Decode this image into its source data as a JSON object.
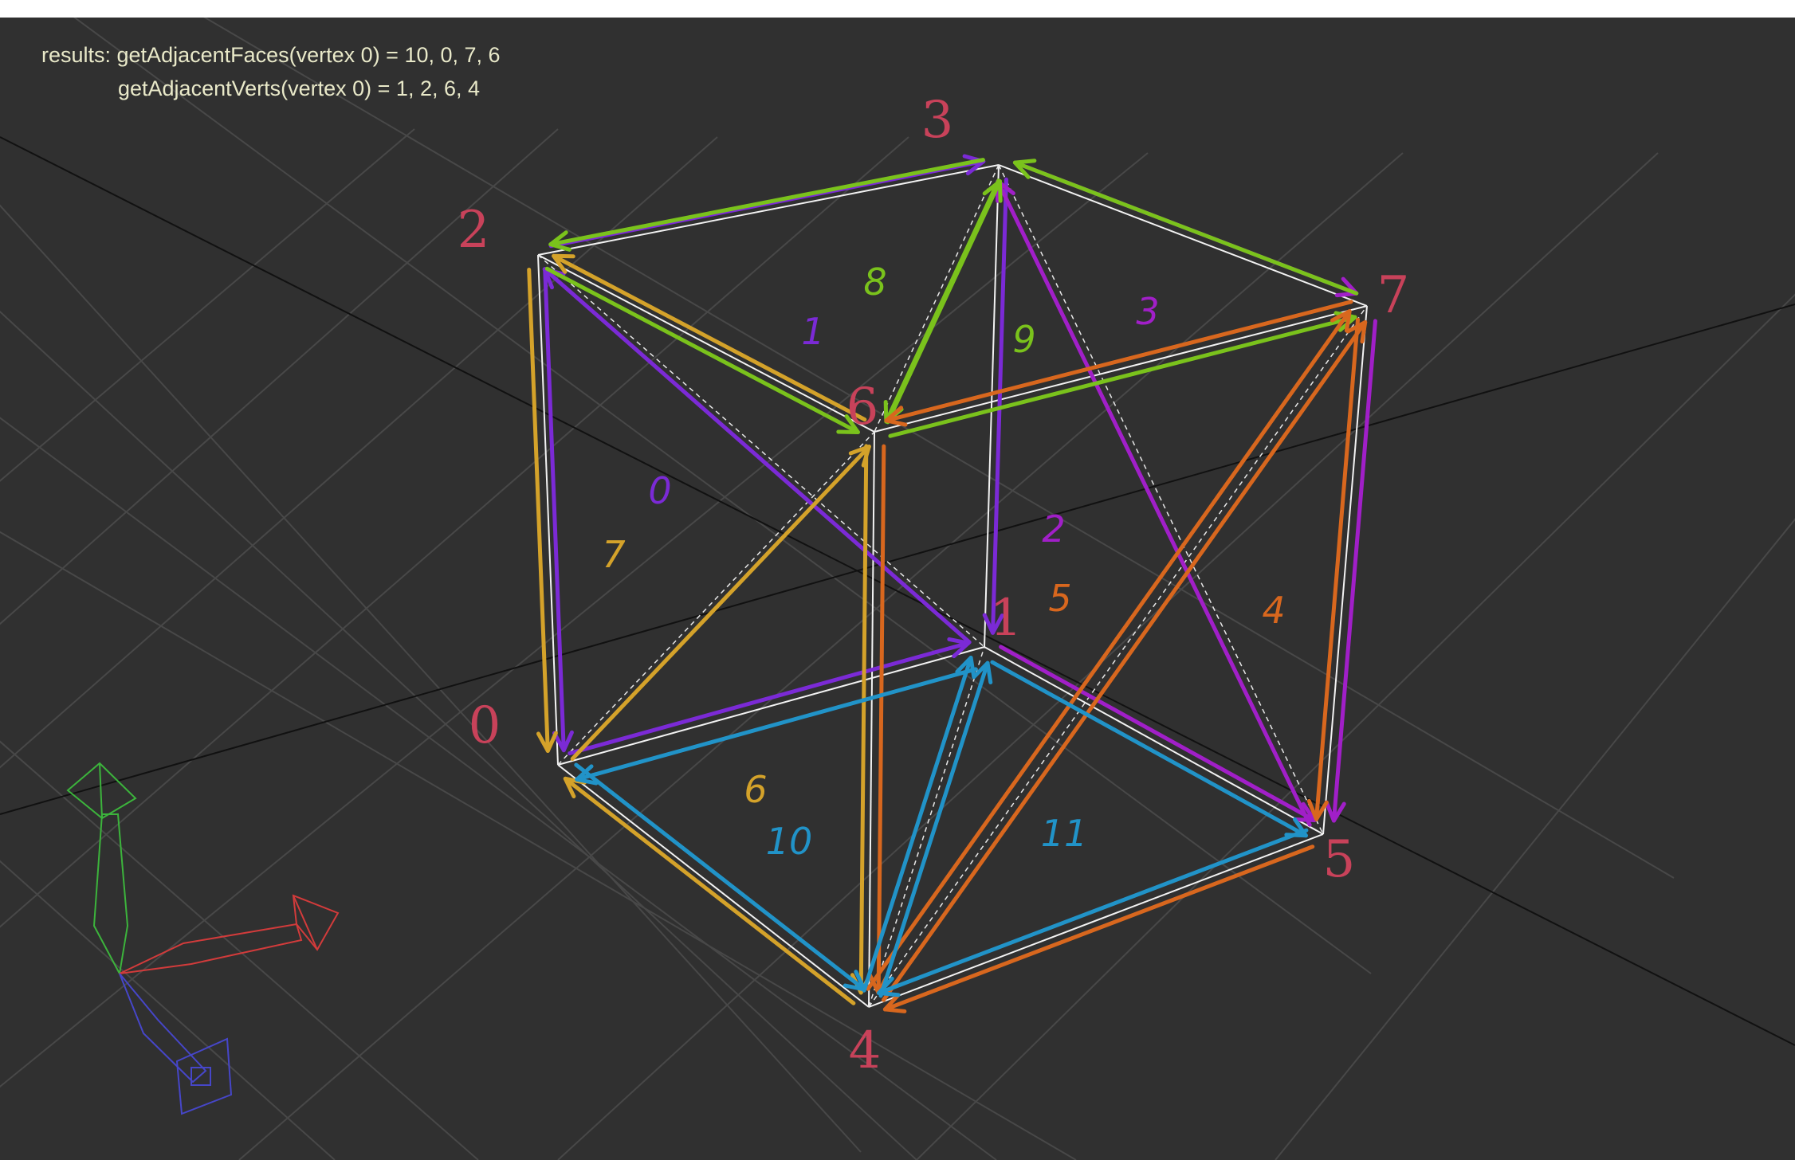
{
  "results": {
    "line1": "results: getAdjacentFaces(vertex 0) = 10, 0, 7, 6",
    "line2": "getAdjacentVerts(vertex 0) = 1, 2, 6, 4"
  },
  "vertex_labels": [
    "0",
    "1",
    "2",
    "3",
    "4",
    "5",
    "6",
    "7"
  ],
  "face_labels": [
    "0",
    "1",
    "2",
    "3",
    "4",
    "5",
    "6",
    "7",
    "8",
    "9",
    "10",
    "11"
  ],
  "colors": {
    "background": "#303030",
    "grid": "#484848",
    "grid_axis": "#111111",
    "cube_wire": "#f2f2f2",
    "vertex_label": "#c8425a",
    "results_text": "#e9e9c9",
    "purple": "#7b2ad6",
    "magenta": "#a11fc8",
    "green": "#7ac21c",
    "gold": "#d4a22a",
    "orange": "#d8671e",
    "blue": "#2193c8",
    "gizmo_x": "#d23b3b",
    "gizmo_y": "#3cb43c",
    "gizmo_z": "#4646c8"
  },
  "gizmo": {
    "axes": [
      "x-axis",
      "y-axis",
      "z-axis"
    ]
  }
}
